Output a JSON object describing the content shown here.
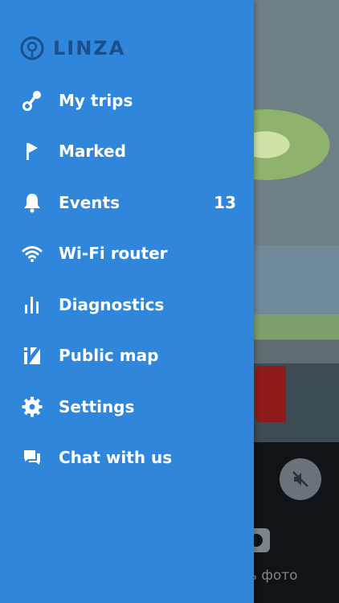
{
  "brand": {
    "name": "LINZA"
  },
  "menu": [
    {
      "label": "My trips",
      "icon": "route-icon"
    },
    {
      "label": "Marked",
      "icon": "flag-icon"
    },
    {
      "label": "Events",
      "icon": "bell-icon",
      "badge": "13"
    },
    {
      "label": "Wi-Fi router",
      "icon": "wifi-icon"
    },
    {
      "label": "Diagnostics",
      "icon": "bars-icon"
    },
    {
      "label": "Public map",
      "icon": "public-map-icon"
    },
    {
      "label": "Settings",
      "icon": "gear-icon"
    },
    {
      "label": "Chat with us",
      "icon": "chat-icon"
    }
  ],
  "background": {
    "photo_text": "ть фото"
  },
  "colors": {
    "drawer": "#2f86db",
    "brand": "#1a4f8c"
  }
}
